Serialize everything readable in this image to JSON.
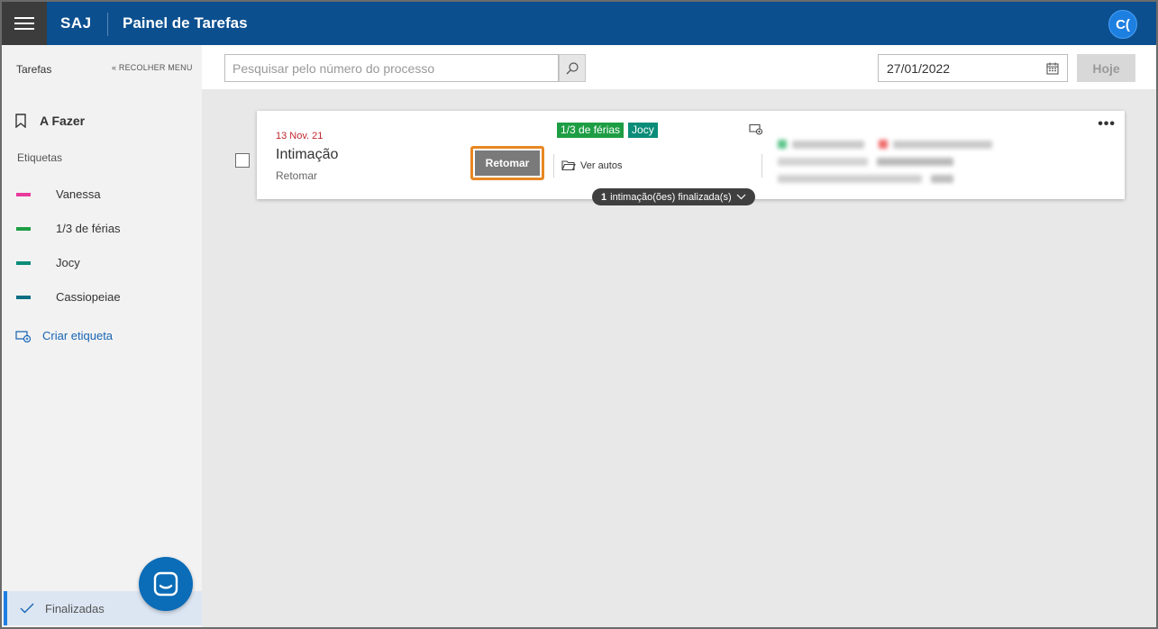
{
  "header": {
    "brand": "SAJ",
    "title": "Painel de Tarefas",
    "avatar_initials": "C(",
    "menu_icon": "hamburger-icon",
    "bar_color": "#0b4f8f"
  },
  "sidebar": {
    "tasks_label": "Tarefas",
    "collapse_label": "« RECOLHER MENU",
    "todo_label": "A Fazer",
    "tags_heading": "Etiquetas",
    "tags": [
      {
        "label": "Vanessa",
        "color": "#e8399c"
      },
      {
        "label": "1/3 de férias",
        "color": "#1e9e44"
      },
      {
        "label": "Jocy",
        "color": "#0a8c79"
      },
      {
        "label": "Cassiopeiae",
        "color": "#0a6e82"
      }
    ],
    "create_tag_label": "Criar etiqueta",
    "finished_label": "Finalizadas",
    "chat_icon": "chat-icon"
  },
  "toolbar": {
    "search_placeholder": "Pesquisar pelo número do processo",
    "date_value": "27/01/2022",
    "today_label": "Hoje"
  },
  "task_card": {
    "date": "13 Nov. 21",
    "title": "Intimação",
    "subtitle": "Retomar",
    "resume_label": "Retomar",
    "tags": [
      {
        "label": "1/3 de férias",
        "color": "#1e9e44"
      },
      {
        "label": "Jocy",
        "color": "#0a8c79"
      }
    ],
    "view_autos_label": "Ver autos",
    "more_label": "•••",
    "finished_count": "1",
    "finished_text": "intimação(ões) finalizada(s)"
  }
}
